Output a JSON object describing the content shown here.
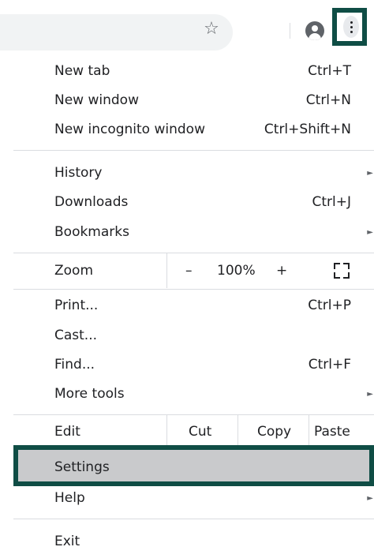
{
  "browser": {
    "star_glyph": "☆",
    "profile_icon": "account-circle-icon",
    "menu_icon": "more-vert-icon",
    "highlight_color": "#0f4d45"
  },
  "menu": {
    "new_tab": {
      "label": "New tab",
      "shortcut": "Ctrl+T"
    },
    "new_window": {
      "label": "New window",
      "shortcut": "Ctrl+N"
    },
    "incognito": {
      "label": "New incognito window",
      "shortcut": "Ctrl+Shift+N"
    },
    "history": {
      "label": "History"
    },
    "downloads": {
      "label": "Downloads",
      "shortcut": "Ctrl+J"
    },
    "bookmarks": {
      "label": "Bookmarks"
    },
    "zoom": {
      "label": "Zoom",
      "minus": "–",
      "value": "100%",
      "plus": "+"
    },
    "print": {
      "label": "Print...",
      "shortcut": "Ctrl+P"
    },
    "cast": {
      "label": "Cast..."
    },
    "find": {
      "label": "Find...",
      "shortcut": "Ctrl+F"
    },
    "more_tools": {
      "label": "More tools"
    },
    "edit": {
      "label": "Edit",
      "cut": "Cut",
      "copy": "Copy",
      "paste": "Paste"
    },
    "settings": {
      "label": "Settings"
    },
    "help": {
      "label": "Help"
    },
    "exit": {
      "label": "Exit"
    },
    "submenu_arrow": "►"
  }
}
